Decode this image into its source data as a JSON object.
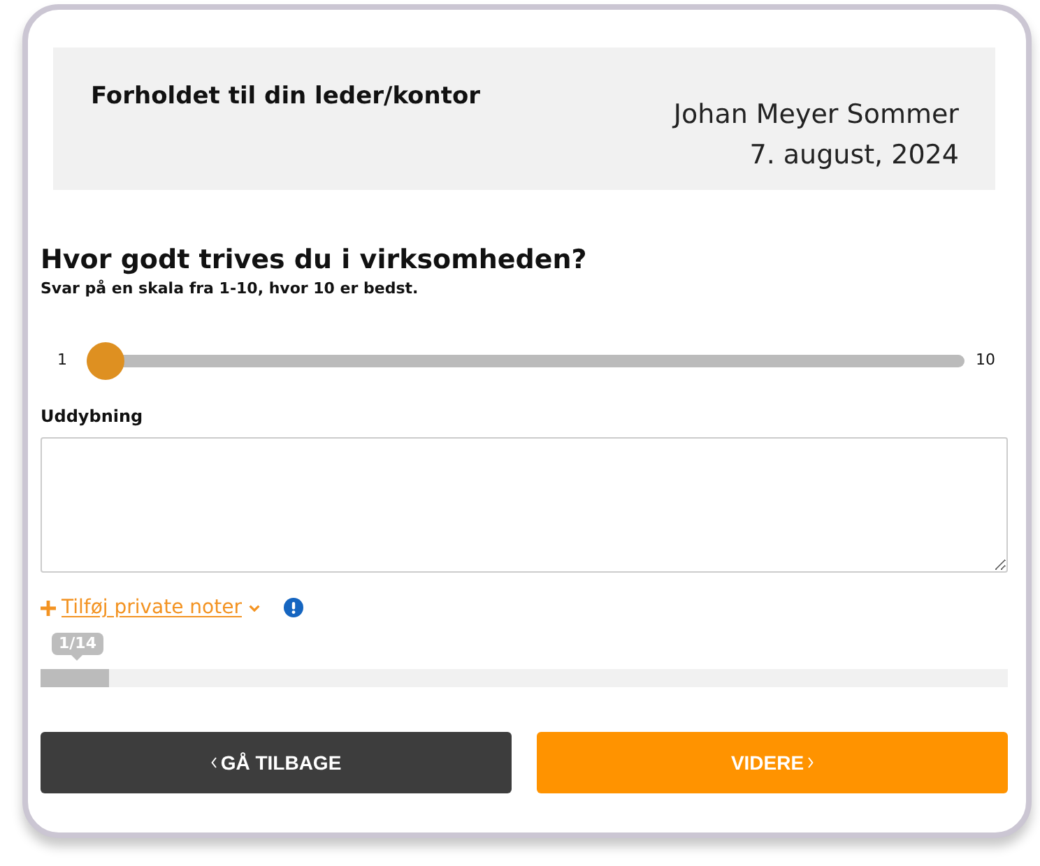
{
  "header": {
    "title": "Forholdet til din leder/kontor",
    "name": "Johan Meyer Sommer",
    "date": "7. august, 2024"
  },
  "question": {
    "title": "Hvor godt trives du i virksomheden?",
    "hint": "Svar på en skala fra 1-10, hvor 10 er bedst.",
    "slider": {
      "min_label": "1",
      "max_label": "10",
      "level": 0
    }
  },
  "elaboration": {
    "label": "Uddybning"
  },
  "notes_link": {
    "label": "Tilføj private noter"
  },
  "progress": {
    "label": "1/14",
    "level": 0.0714
  },
  "buttons": [
    {
      "kind": "back",
      "label": "GÅ TILBAGE"
    },
    {
      "kind": "next",
      "label": "VIDERE"
    }
  ]
}
